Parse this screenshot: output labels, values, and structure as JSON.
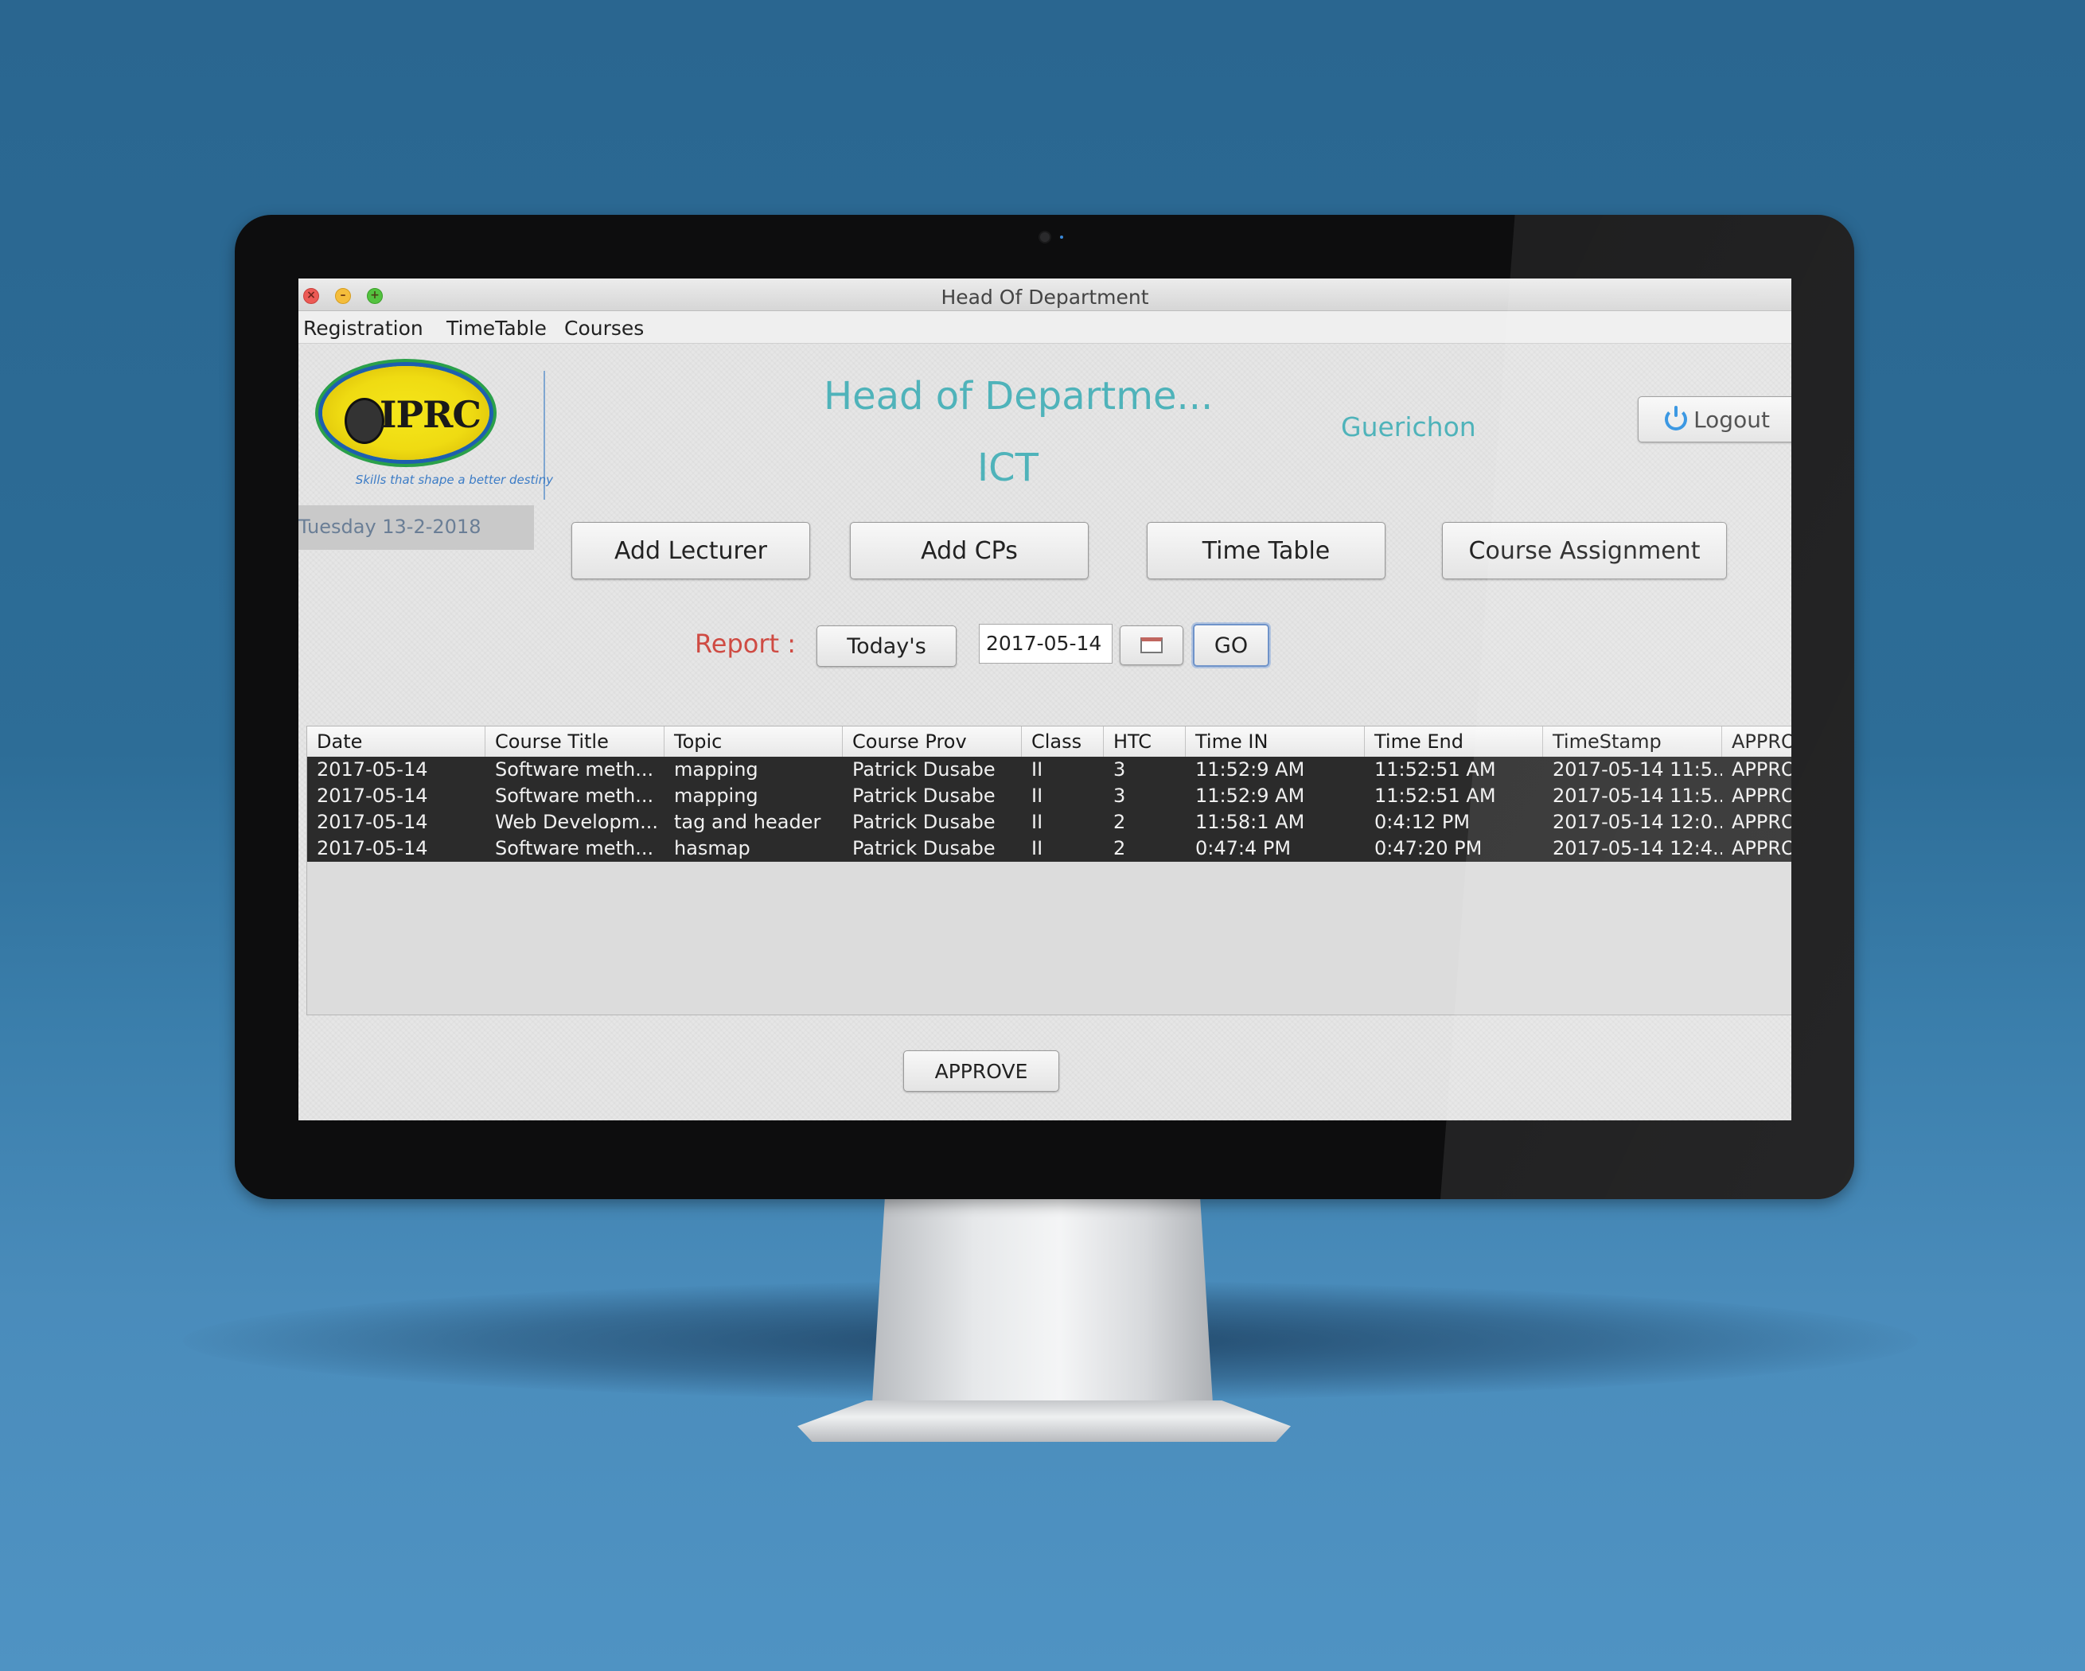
{
  "window": {
    "title": "Head Of Department",
    "controls": [
      "close",
      "minimize",
      "maximize"
    ]
  },
  "menubar": {
    "items": [
      "Registration",
      "TimeTable",
      "Courses"
    ]
  },
  "branding": {
    "logo_text": "IPRC",
    "tagline": "Skills that shape a better destiny"
  },
  "date_display": "Tuesday 13-2-2018",
  "header": {
    "title": "Head of Departme...",
    "department": "ICT",
    "username": "Guerichon",
    "logout_label": "Logout"
  },
  "nav_buttons": {
    "add_lecturer": "Add Lecturer",
    "add_cps": "Add CPs",
    "time_table": "Time Table",
    "course_assignment": "Course Assignment"
  },
  "report": {
    "label": "Report :",
    "todays_label": "Today's",
    "date_value": "2017-05-14",
    "go_label": "GO"
  },
  "table": {
    "columns": [
      "Date",
      "Course Title",
      "Topic",
      "Course Prov",
      "Class",
      "HTC",
      "Time IN",
      "Time End",
      "TimeStamp",
      "APPRO"
    ],
    "rows": [
      [
        "2017-05-14",
        "Software meth...",
        "mapping",
        "Patrick Dusabe",
        "II",
        "3",
        "11:52:9 AM",
        "11:52:51 AM",
        "2017-05-14 11:5...",
        "APPRO"
      ],
      [
        "2017-05-14",
        "Software meth...",
        "mapping",
        "Patrick Dusabe",
        "II",
        "3",
        "11:52:9 AM",
        "11:52:51 AM",
        "2017-05-14 11:5...",
        "APPRO"
      ],
      [
        "2017-05-14",
        "Web Developm...",
        "tag and header",
        "Patrick Dusabe",
        "II",
        "2",
        "11:58:1 AM",
        "0:4:12 PM",
        "2017-05-14 12:0...",
        "APPRO"
      ],
      [
        "2017-05-14",
        "Software meth...",
        "hasmap",
        "Patrick Dusabe",
        "II",
        "2",
        "0:47:4 PM",
        "0:47:20 PM",
        "2017-05-14 12:4...",
        "APPRO"
      ]
    ]
  },
  "approve_label": "APPROVE",
  "colors": {
    "background": "#2d6d97",
    "accent_teal": "#4fb3ba",
    "report_red": "#cf4b43",
    "table_selected": "#2b2b2b"
  },
  "icons": [
    "close-icon",
    "minimize-icon",
    "maximize-icon",
    "power-icon",
    "calendar-icon",
    "apple-logo-icon"
  ]
}
